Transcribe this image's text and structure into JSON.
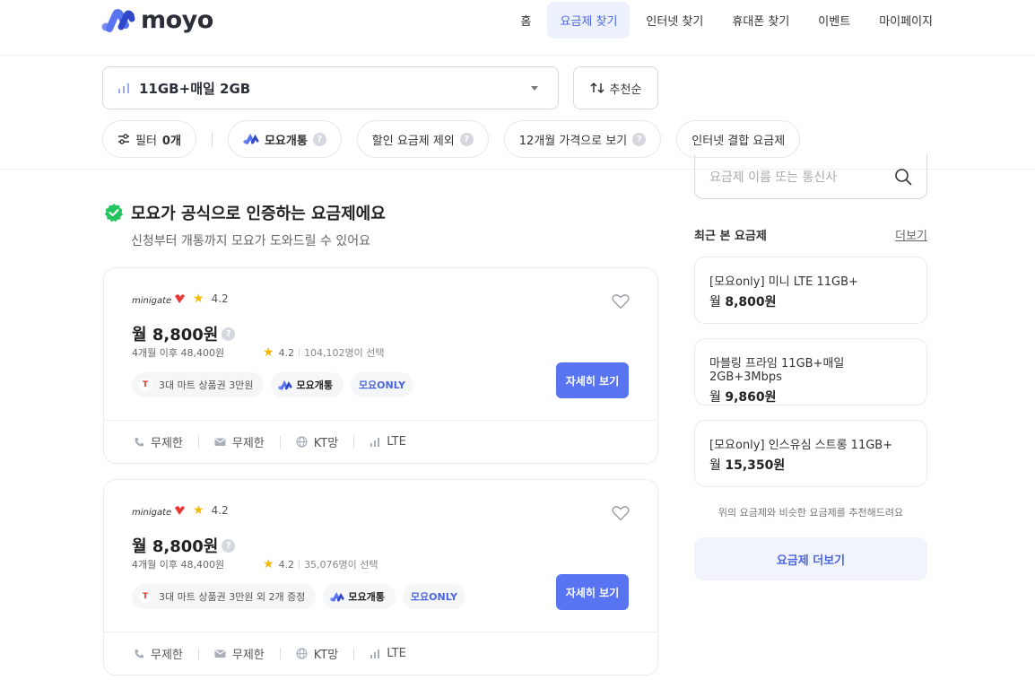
{
  "header": {
    "logo_text": "moyo",
    "nav": [
      {
        "label": "홈"
      },
      {
        "label": "요금제 찾기",
        "active": true
      },
      {
        "label": "인터넷 찾기"
      },
      {
        "label": "휴대폰 찾기"
      },
      {
        "label": "이벤트"
      },
      {
        "label": "마이페이지"
      }
    ]
  },
  "filters": {
    "plan_select_value": "11GB+매일 2GB",
    "sort_label": "추천순",
    "filter_label": "필터",
    "filter_count": "0개",
    "chips": {
      "moyo": "모요개통",
      "exclude_discount": "할인 요금제 제외",
      "twelve_month": "12개월 가격으로 보기",
      "internet_bundle": "인터넷 결합 요금제"
    }
  },
  "certified": {
    "title": "모요가 공식으로 인증하는 요금제에요",
    "subtitle": "신청부터 개통까지 모요가 도와드릴 수 있어요"
  },
  "plans": [
    {
      "carrier": "minigate",
      "carrier_rating": "4.2",
      "price": "월 8,800원",
      "after": "4개월 이후 48,400원",
      "rating": "4.2",
      "selected": "104,102명이 선택",
      "gift": "3대 마트 상품권 3만원",
      "moyo_tag": "모요개통",
      "only_tag": "모요ONLY",
      "detail_label": "자세히 보기",
      "specs": {
        "call": "무제한",
        "sms": "무제한",
        "network": "KT망",
        "type": "LTE"
      }
    },
    {
      "carrier": "minigate",
      "carrier_rating": "4.2",
      "price": "월 8,800원",
      "after": "4개월 이후 48,400원",
      "rating": "4.2",
      "selected": "35,076명이 선택",
      "gift": "3대 마트 상품권 3만원 외 2개 증정",
      "moyo_tag": "모요개통",
      "only_tag": "모요ONLY",
      "detail_label": "자세히 보기",
      "specs": {
        "call": "무제한",
        "sms": "무제한",
        "network": "KT망",
        "type": "LTE"
      }
    }
  ],
  "sidebar": {
    "search_placeholder": "요금제 이름 또는 통신사",
    "recent_title": "최근 본 요금제",
    "recent_more": "더보기",
    "recent": [
      {
        "name": "[모요only] 미니 LTE 11GB+",
        "price_prefix": "월",
        "price": "8,800원"
      },
      {
        "name": "마블링 프라임 11GB+매일2GB+3Mbps",
        "price_prefix": "월",
        "price": "9,860원"
      },
      {
        "name": "[모요only] 인스유심 스트롱 11GB+",
        "price_prefix": "월",
        "price": "15,350원"
      }
    ],
    "similar_text": "위의 요금제와 비슷한 요금제를 추천해드려요",
    "more_plans_label": "요금제 더보기"
  },
  "colors": {
    "accent": "#5874f0",
    "accent_text": "#4c66e2",
    "check": "#22c55e"
  }
}
